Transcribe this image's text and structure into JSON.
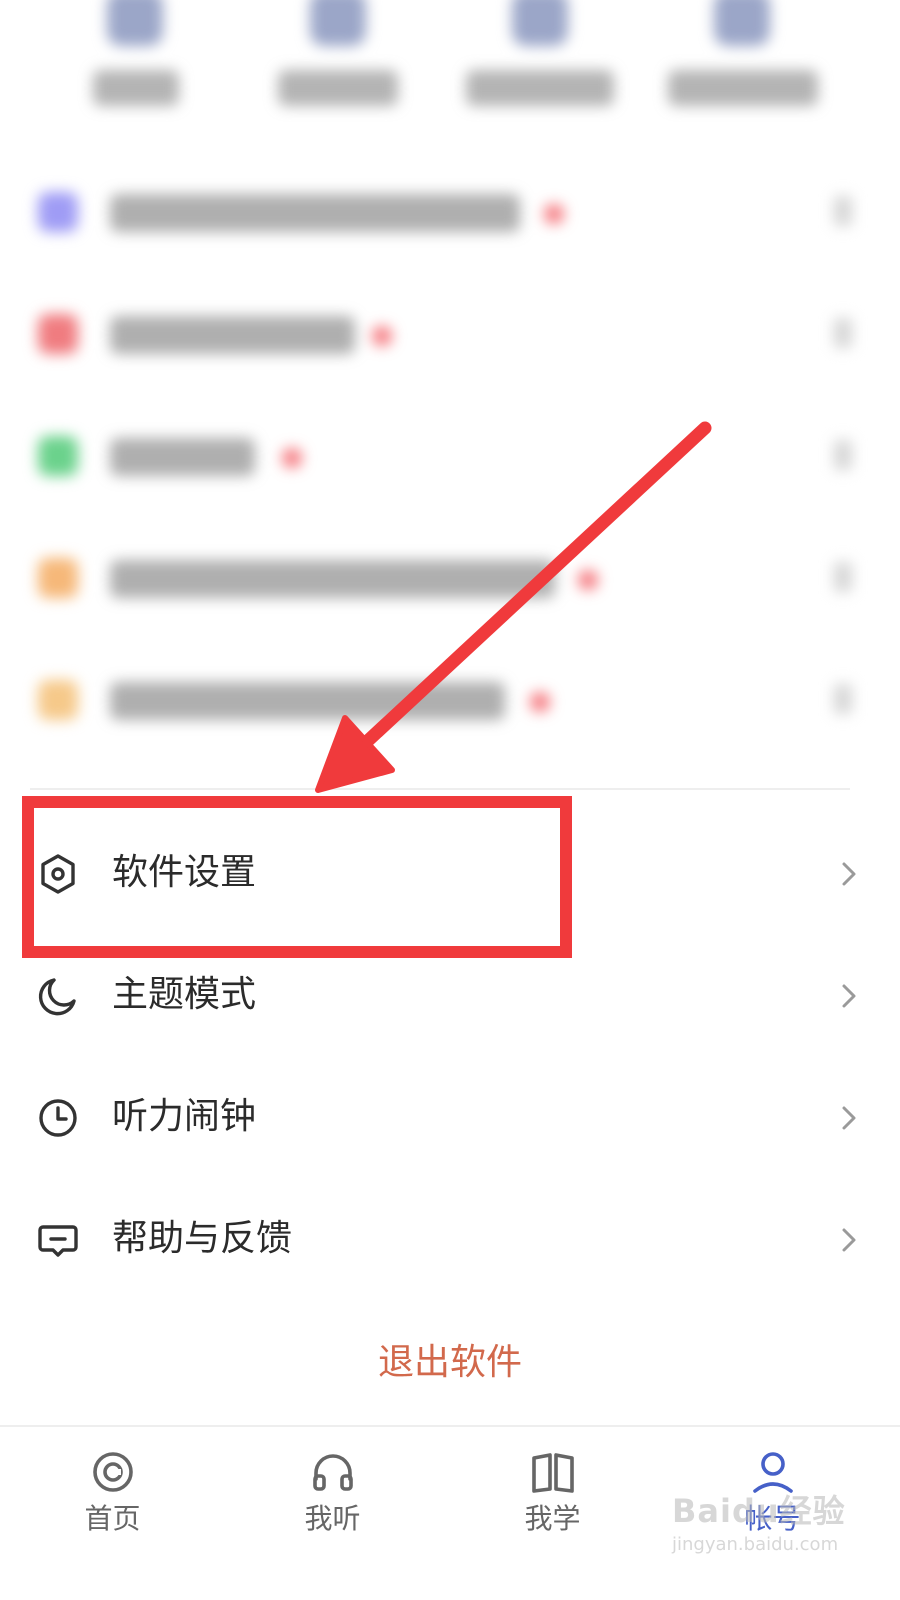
{
  "menu": {
    "items": [
      {
        "label": "软件设置",
        "icon": "hexagon-settings-icon"
      },
      {
        "label": "主题模式",
        "icon": "moon-icon"
      },
      {
        "label": "听力闹钟",
        "icon": "clock-icon"
      },
      {
        "label": "帮助与反馈",
        "icon": "feedback-message-icon"
      }
    ],
    "chevron_icon": "chevron-right-icon"
  },
  "logout": {
    "label": "退出软件",
    "color": "#d2694c"
  },
  "bottom_nav": {
    "items": [
      {
        "label": "首页",
        "icon": "home-circle-icon",
        "active": false
      },
      {
        "label": "我听",
        "icon": "headphones-icon",
        "active": false
      },
      {
        "label": "我学",
        "icon": "book-icon",
        "active": false
      },
      {
        "label": "帐号",
        "icon": "user-icon",
        "active": true
      }
    ],
    "active_color": "#4660c8"
  },
  "annotation": {
    "color": "#f03a3c",
    "target": "软件设置"
  },
  "blurred_icon_colors": [
    "#9f9cf5",
    "#f07c80",
    "#6bd28c",
    "#f6b879",
    "#f6c98a"
  ],
  "watermark": {
    "logo": "Baidu经验",
    "sub": "jingyan.baidu.com"
  }
}
